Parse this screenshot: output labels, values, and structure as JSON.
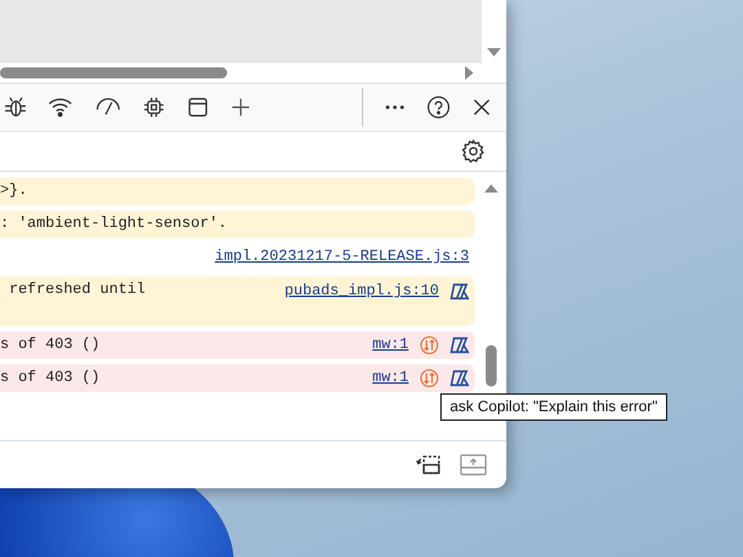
{
  "console": {
    "messages": [
      {
        "kind": "warning",
        "text": ">}.",
        "copilot": false,
        "network": false
      },
      {
        "kind": "warning",
        "text": ": 'ambient-light-sensor'.",
        "copilot": false,
        "network": false
      },
      {
        "kind": "info",
        "source": "impl.20231217-5-RELEASE.js:3",
        "copilot": false,
        "network": false
      },
      {
        "kind": "warning",
        "text": " refreshed until",
        "source": "pubads_impl.js:10",
        "copilot": true,
        "network": false
      },
      {
        "kind": "error",
        "text": "s of 403 ()",
        "source": "mw:1",
        "copilot": true,
        "network": true
      },
      {
        "kind": "error",
        "text": "s of 403 ()",
        "source": "mw:1",
        "copilot": true,
        "network": true
      }
    ]
  },
  "tooltip": {
    "text": "ask Copilot: \"Explain this error\""
  }
}
